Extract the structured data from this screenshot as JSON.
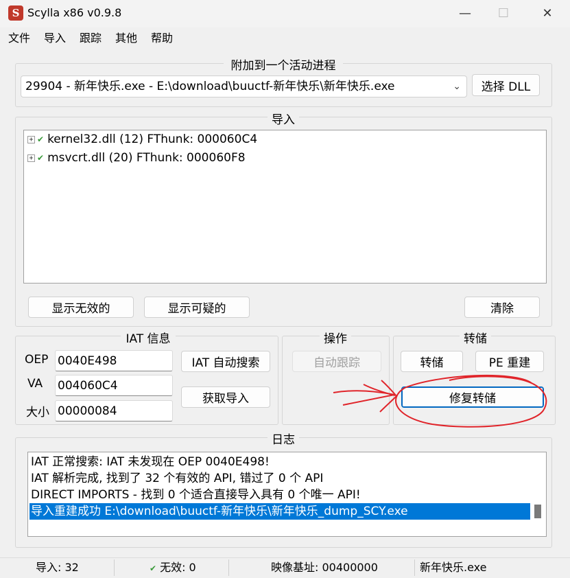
{
  "window": {
    "title": "Scylla x86 v0.9.8",
    "minimize_glyph": "—",
    "maximize_glyph": "☐",
    "close_glyph": "✕",
    "app_icon_glyph": "S"
  },
  "menu": [
    "文件",
    "导入",
    "跟踪",
    "其他",
    "帮助"
  ],
  "attach": {
    "group_title": "附加到一个活动进程",
    "process_value": "29904 - 新年快乐.exe - E:\\download\\buuctf-新年快乐\\新年快乐.exe",
    "pick_dll_label": "选择 DLL"
  },
  "imports": {
    "group_title": "导入",
    "tree": [
      {
        "label": "kernel32.dll (12) FThunk: 000060C4"
      },
      {
        "label": "msvcrt.dll (20) FThunk: 000060F8"
      }
    ],
    "show_invalid_label": "显示无效的",
    "show_suspect_label": "显示可疑的",
    "clear_label": "清除"
  },
  "iat": {
    "group_title": "IAT 信息",
    "oep_label": "OEP",
    "oep_value": "0040E498",
    "va_label": "VA",
    "va_value": "004060C4",
    "size_label": "大小",
    "size_value": "00000084",
    "autosearch_label": "IAT 自动搜索",
    "get_imports_label": "获取导入"
  },
  "actions": {
    "group_title": "操作",
    "autotrace_label": "自动跟踪"
  },
  "dump": {
    "group_title": "转储",
    "dump_label": "转储",
    "pe_rebuild_label": "PE 重建",
    "fix_dump_label": "修复转储"
  },
  "log": {
    "group_title": "日志",
    "lines": [
      "IAT 正常搜索: IAT 未发现在 OEP 0040E498!",
      "IAT 解析完成, 找到了 32 个有效的 API, 错过了 0 个 API",
      "DIRECT IMPORTS - 找到 0 个适合直接导入具有 0 个唯一 API!",
      "导入重建成功 E:\\download\\buuctf-新年快乐\\新年快乐_dump_SCY.exe"
    ],
    "selected_index": 3
  },
  "status": {
    "imports": "导入: 32",
    "invalid": "无效: 0",
    "image_base": "映像基址: 00400000",
    "module": "新年快乐.exe"
  },
  "colors": {
    "annotation_red": "#e0242a",
    "selection_blue": "#0078d7",
    "check_green": "#3a9a3a"
  }
}
